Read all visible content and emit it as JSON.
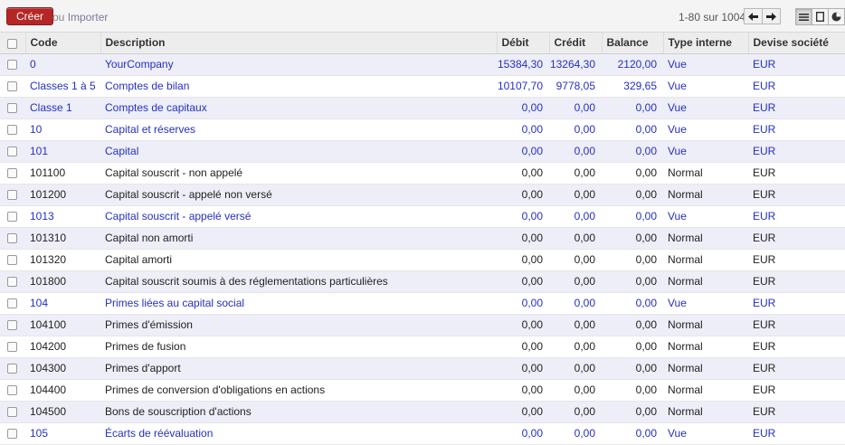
{
  "toolbar": {
    "create_label": "Créer",
    "or_label": "ou",
    "import_label": "Importer",
    "pager_text": "1-80 sur 1004",
    "pager_prev_icon": "arrow-left-icon",
    "pager_next_icon": "arrow-right-icon",
    "view_list_icon": "list-view-icon",
    "view_form_icon": "form-view-icon",
    "view_graph_icon": "graph-view-icon"
  },
  "table": {
    "columns": [
      "Code",
      "Description",
      "Débit",
      "Crédit",
      "Balance",
      "Type interne",
      "Devise société"
    ],
    "rows": [
      {
        "code": "0",
        "desc": "YourCompany",
        "debit": "15384,30",
        "credit": "13264,30",
        "balance": "2120,00",
        "type": "Vue",
        "currency": "EUR"
      },
      {
        "code": "Classes 1 à 5",
        "desc": "Comptes de bilan",
        "debit": "10107,70",
        "credit": "9778,05",
        "balance": "329,65",
        "type": "Vue",
        "currency": "EUR"
      },
      {
        "code": "Classe 1",
        "desc": "Comptes de capitaux",
        "debit": "0,00",
        "credit": "0,00",
        "balance": "0,00",
        "type": "Vue",
        "currency": "EUR"
      },
      {
        "code": "10",
        "desc": "Capital et réserves",
        "debit": "0,00",
        "credit": "0,00",
        "balance": "0,00",
        "type": "Vue",
        "currency": "EUR"
      },
      {
        "code": "101",
        "desc": "Capital",
        "debit": "0,00",
        "credit": "0,00",
        "balance": "0,00",
        "type": "Vue",
        "currency": "EUR"
      },
      {
        "code": "101100",
        "desc": "Capital souscrit - non appelé",
        "debit": "0,00",
        "credit": "0,00",
        "balance": "0,00",
        "type": "Normal",
        "currency": "EUR"
      },
      {
        "code": "101200",
        "desc": "Capital souscrit - appelé non versé",
        "debit": "0,00",
        "credit": "0,00",
        "balance": "0,00",
        "type": "Normal",
        "currency": "EUR"
      },
      {
        "code": "1013",
        "desc": "Capital souscrit - appelé versé",
        "debit": "0,00",
        "credit": "0,00",
        "balance": "0,00",
        "type": "Vue",
        "currency": "EUR"
      },
      {
        "code": "101310",
        "desc": "Capital non amorti",
        "debit": "0,00",
        "credit": "0,00",
        "balance": "0,00",
        "type": "Normal",
        "currency": "EUR"
      },
      {
        "code": "101320",
        "desc": "Capital amorti",
        "debit": "0,00",
        "credit": "0,00",
        "balance": "0,00",
        "type": "Normal",
        "currency": "EUR"
      },
      {
        "code": "101800",
        "desc": "Capital souscrit soumis à des réglementations particulières",
        "debit": "0,00",
        "credit": "0,00",
        "balance": "0,00",
        "type": "Normal",
        "currency": "EUR"
      },
      {
        "code": "104",
        "desc": "Primes liées au capital social",
        "debit": "0,00",
        "credit": "0,00",
        "balance": "0,00",
        "type": "Vue",
        "currency": "EUR"
      },
      {
        "code": "104100",
        "desc": "Primes d'émission",
        "debit": "0,00",
        "credit": "0,00",
        "balance": "0,00",
        "type": "Normal",
        "currency": "EUR"
      },
      {
        "code": "104200",
        "desc": "Primes de fusion",
        "debit": "0,00",
        "credit": "0,00",
        "balance": "0,00",
        "type": "Normal",
        "currency": "EUR"
      },
      {
        "code": "104300",
        "desc": "Primes d'apport",
        "debit": "0,00",
        "credit": "0,00",
        "balance": "0,00",
        "type": "Normal",
        "currency": "EUR"
      },
      {
        "code": "104400",
        "desc": "Primes de conversion d'obligations en actions",
        "debit": "0,00",
        "credit": "0,00",
        "balance": "0,00",
        "type": "Normal",
        "currency": "EUR"
      },
      {
        "code": "104500",
        "desc": "Bons de souscription d'actions",
        "debit": "0,00",
        "credit": "0,00",
        "balance": "0,00",
        "type": "Normal",
        "currency": "EUR"
      },
      {
        "code": "105",
        "desc": "Écarts de réévaluation",
        "debit": "0,00",
        "credit": "0,00",
        "balance": "0,00",
        "type": "Vue",
        "currency": "EUR"
      }
    ]
  },
  "colors": {
    "create_button": "#b52626",
    "view_row_text": "#2430c2",
    "odd_row_bg": "#eeeef8"
  }
}
